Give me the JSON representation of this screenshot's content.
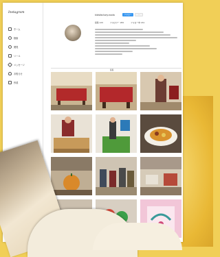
{
  "sidebar": {
    "logo": "Instagram",
    "items": [
      {
        "label": "ホーム",
        "icon": "home-icon"
      },
      {
        "label": "検索",
        "icon": "search-icon"
      },
      {
        "label": "発見",
        "icon": "compass-icon"
      },
      {
        "label": "リール",
        "icon": "reels-icon"
      },
      {
        "label": "メッセージ",
        "icon": "message-icon"
      },
      {
        "label": "お知らせ",
        "icon": "heart-icon"
      },
      {
        "label": "作成",
        "icon": "plus-icon"
      }
    ]
  },
  "profile": {
    "username": "kidsfactory.noda",
    "follow_label": "フォロー",
    "message_label": "...",
    "stats": [
      {
        "label": "投稿 129"
      },
      {
        "label": "フォロワー 284"
      },
      {
        "label": "フォロー中 241"
      }
    ]
  },
  "tabs": {
    "posts_label": "投稿"
  },
  "colors": {
    "accent": "#3897f0",
    "background": "#f1cf57"
  },
  "photos": [
    {
      "name": "photo-billiards-table-1",
      "scene": "room with red billiard table"
    },
    {
      "name": "photo-billiards-table-2",
      "scene": "red billiard table"
    },
    {
      "name": "photo-person-standing",
      "scene": "person in room"
    },
    {
      "name": "photo-child-crafting",
      "scene": "child at wooden table"
    },
    {
      "name": "photo-green-mat",
      "scene": "child on green mat"
    },
    {
      "name": "photo-food-plate",
      "scene": "food on plate"
    },
    {
      "name": "photo-hall-pumpkin",
      "scene": "hall with pumpkin"
    },
    {
      "name": "photo-group-kids",
      "scene": "group of children"
    },
    {
      "name": "photo-hall-wide",
      "scene": "wide hall"
    },
    {
      "name": "photo-gathering",
      "scene": "people gathering"
    },
    {
      "name": "photo-colorful-event",
      "scene": "colorful event"
    },
    {
      "name": "photo-pink-graphic",
      "scene": "pink graphic"
    }
  ]
}
